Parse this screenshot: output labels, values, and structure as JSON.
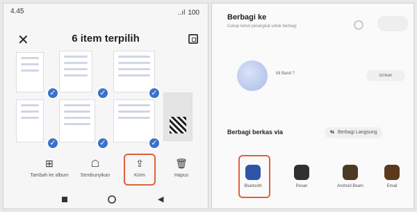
{
  "status": {
    "time": "4.45",
    "signal": "..ıl",
    "battery": "100"
  },
  "header": {
    "title": "6 item terpilih"
  },
  "actions": [
    {
      "icon": "⊞",
      "label": "Tambah ke album"
    },
    {
      "icon": "☖",
      "label": "Sembunyikan"
    },
    {
      "icon": "⇪",
      "label": "Kirim"
    },
    {
      "icon": "🗑",
      "label": "Hapus"
    }
  ],
  "share": {
    "title": "Berbagi ke",
    "subtitle": "Cukup ketuk perangkat untuk berbagi",
    "device_name": "Mi Band ?",
    "device_button": "Izinkan",
    "section_title": "Berbagi berkas via",
    "direct_label": "Berbagi Langsung",
    "direct_icon": "⇆",
    "apps": [
      {
        "label": "Bluetooth",
        "color": "#2f55a8"
      },
      {
        "label": "Pesan",
        "color": "#303030"
      },
      {
        "label": "Android Beam",
        "color": "#4a3b22"
      },
      {
        "label": "Email",
        "color": "#5b3a1c"
      }
    ]
  },
  "colors": {
    "check": "#3b72c9",
    "highlight": "#e0603a"
  }
}
